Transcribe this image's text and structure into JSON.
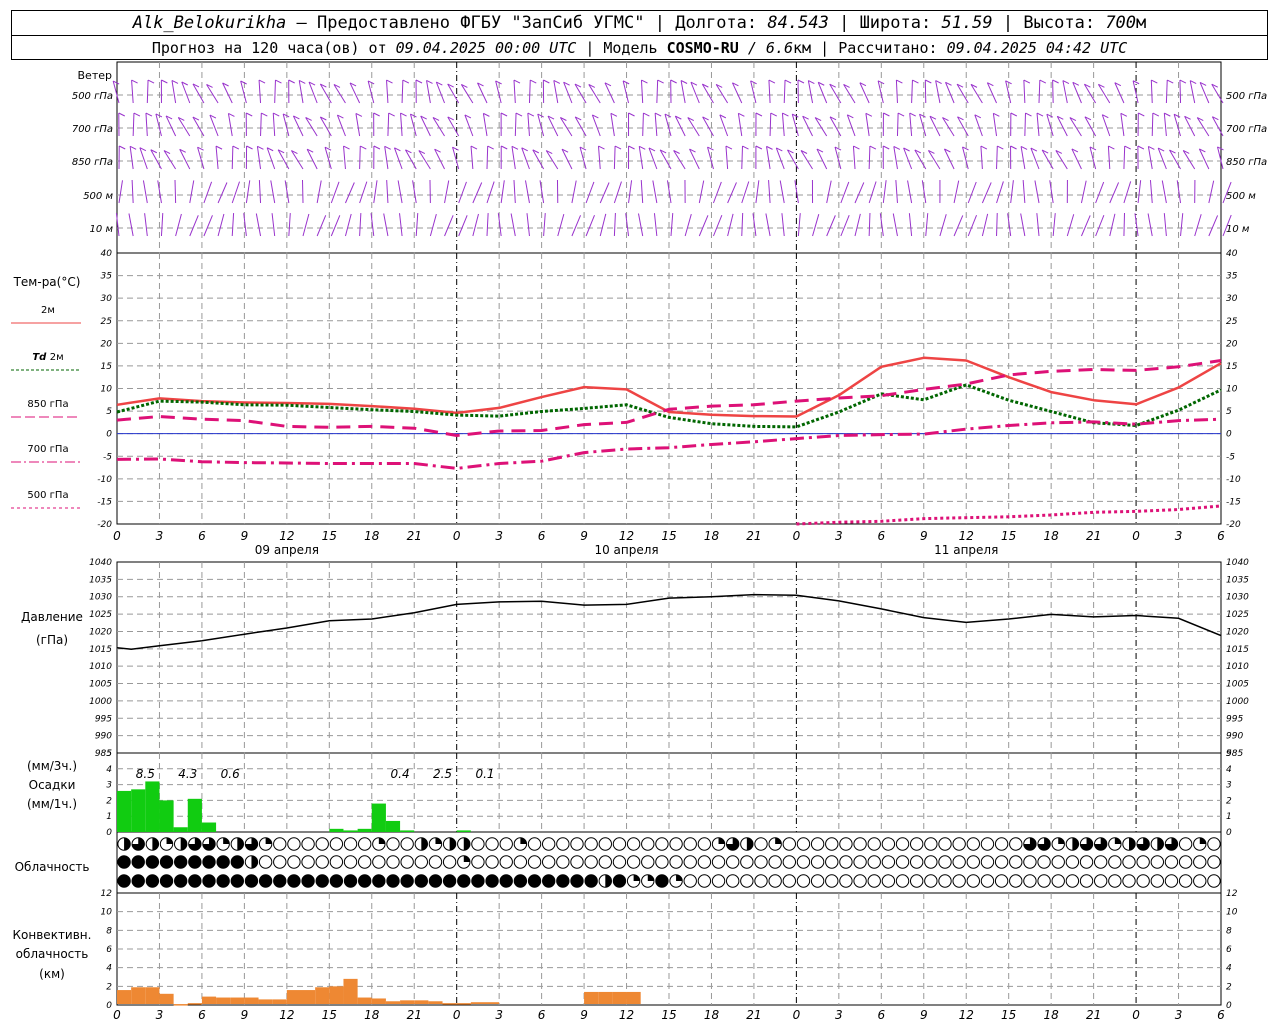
{
  "header": {
    "station": "Alk_Belokurikha",
    "provided": "– Предоставлено ФГБУ \"ЗапСиб УГМС\"",
    "lon_label": "Долгота:",
    "lon": "84.543",
    "lat_label": "Широта:",
    "lat": "51.59",
    "alt_label": "Высота:",
    "alt": "700",
    "alt_unit": "м",
    "forecast_label": "Прогноз на 120 часа(ов) от",
    "forecast_start": "09.04.2025 00:00 UTC",
    "model_label": "Модель",
    "model": "COSMO-RU",
    "resolution": "/ 6.6",
    "res_unit": "км",
    "calc_label": "Рассчитано:",
    "calc_time": "09.04.2025 04:42 UTC"
  },
  "wind_panel": {
    "title": "Ветер",
    "levels": [
      "500 гПа",
      "700 гПа",
      "850 гПа",
      "500 м",
      "10  м"
    ],
    "barb_color": "#9933cc"
  },
  "temperature_panel": {
    "title": "Тем-ра(°C)",
    "legend": [
      {
        "label": "2м",
        "color": "#ee4444",
        "style": "solid"
      },
      {
        "label_em": "Td",
        "label": "2м",
        "color": "#006600",
        "style": "dotted"
      },
      {
        "label": "850 гПа",
        "color": "#dd1177",
        "style": "dashed"
      },
      {
        "label": "700 гПа",
        "color": "#dd1177",
        "style": "dashdot"
      },
      {
        "label": "500 гПа",
        "color": "#dd1177",
        "style": "dot"
      }
    ]
  },
  "pressure_panel": {
    "title": "Давление",
    "unit": "(гПа)"
  },
  "precip_panel": {
    "unit3": "(мм/3ч.)",
    "title": "Осадки",
    "unit1": "(мм/1ч.)",
    "totals": [
      {
        "x": 2,
        "text": "8.5"
      },
      {
        "x": 5,
        "text": "4.3"
      },
      {
        "x": 8,
        "text": "0.6"
      },
      {
        "x": 20,
        "text": "0.4"
      },
      {
        "x": 23,
        "text": "2.5"
      },
      {
        "x": 26,
        "text": "0.1"
      }
    ]
  },
  "cloud_panel": {
    "title": "Облачность"
  },
  "convective_panel": {
    "lines": [
      "Конвективн.",
      "облачность",
      "(км)"
    ]
  },
  "time_axis": {
    "hour_labels": [
      "0",
      "3",
      "6",
      "9",
      "12",
      "15",
      "18",
      "21",
      "0",
      "3",
      "6",
      "9",
      "12",
      "15",
      "18",
      "21",
      "0",
      "3",
      "6",
      "9",
      "12",
      "15",
      "18",
      "21",
      "0",
      "3",
      "6"
    ],
    "day_labels": [
      {
        "x": 12,
        "text": "09 апреля"
      },
      {
        "x": 36,
        "text": "10 апреля"
      },
      {
        "x": 60,
        "text": "11 апреля"
      }
    ]
  },
  "colors": {
    "t2m": "#ee4444",
    "td2m": "#006600",
    "t850": "#dd1177",
    "zero_line": "#2233cc",
    "pressure": "#000000",
    "precip": "#11cc11",
    "convective": "#ee8833",
    "grid": "#999999"
  },
  "chart_data": [
    {
      "type": "line",
      "panel": "temperature",
      "x_unit": "forecast hour",
      "xlim": [
        0,
        78
      ],
      "ylim": [
        -20,
        40
      ],
      "yticks": [
        -20,
        -15,
        -10,
        -5,
        0,
        5,
        10,
        15,
        20,
        25,
        30,
        35,
        40
      ],
      "series": [
        {
          "key": "t2m",
          "x": [
            0,
            3,
            6,
            9,
            12,
            15,
            18,
            21,
            24,
            27,
            30,
            33,
            36,
            39,
            42,
            45,
            48,
            51,
            54,
            57,
            60,
            63,
            66,
            69,
            72,
            75,
            78
          ],
          "values": [
            6.4,
            7.8,
            7.2,
            6.9,
            6.8,
            6.6,
            6.1,
            5.5,
            4.6,
            5.7,
            8.1,
            10.3,
            9.8,
            4.8,
            4.2,
            3.9,
            3.8,
            8.5,
            14.8,
            16.8,
            16.2,
            12.5,
            9.2,
            7.4,
            6.5,
            10.2,
            15.6
          ]
        },
        {
          "key": "td2m",
          "x": [
            0,
            3,
            6,
            9,
            12,
            15,
            18,
            21,
            24,
            27,
            30,
            33,
            36,
            39,
            42,
            45,
            48,
            51,
            54,
            57,
            60,
            63,
            66,
            69,
            72,
            75,
            78
          ],
          "values": [
            4.8,
            7.2,
            7.0,
            6.4,
            6.3,
            5.8,
            5.3,
            4.9,
            4.1,
            3.9,
            4.9,
            5.6,
            6.4,
            3.6,
            2.2,
            1.6,
            1.5,
            4.8,
            8.8,
            7.5,
            10.8,
            7.4,
            4.9,
            2.4,
            1.8,
            5.2,
            9.7
          ]
        },
        {
          "key": "t850",
          "x": [
            0,
            3,
            6,
            9,
            12,
            15,
            18,
            21,
            24,
            27,
            30,
            33,
            36,
            39,
            42,
            45,
            48,
            51,
            54,
            57,
            60,
            63,
            66,
            69,
            72,
            75,
            78
          ],
          "values": [
            3.0,
            3.8,
            3.2,
            2.9,
            1.6,
            1.4,
            1.6,
            1.2,
            -0.4,
            0.6,
            0.7,
            2.0,
            2.5,
            5.4,
            6.1,
            6.4,
            7.2,
            7.9,
            8.4,
            9.8,
            11.0,
            13.0,
            13.8,
            14.2,
            14.0,
            14.8,
            16.2
          ]
        },
        {
          "key": "t700",
          "x": [
            0,
            3,
            6,
            9,
            12,
            15,
            18,
            21,
            24,
            27,
            30,
            33,
            36,
            39,
            42,
            45,
            48,
            51,
            54,
            57,
            60,
            63,
            66,
            69,
            72,
            75,
            78
          ],
          "values": [
            -5.7,
            -5.6,
            -6.2,
            -6.4,
            -6.5,
            -6.6,
            -6.6,
            -6.6,
            -7.7,
            -6.6,
            -6.1,
            -4.2,
            -3.4,
            -3.1,
            -2.4,
            -1.8,
            -1.1,
            -0.4,
            -0.2,
            -0.1,
            1.0,
            1.8,
            2.4,
            2.6,
            2.1,
            2.9,
            3.2
          ]
        },
        {
          "key": "t500",
          "x": [
            48,
            51,
            54,
            57,
            60,
            63,
            66,
            69,
            72,
            75,
            78
          ],
          "values": [
            -20.0,
            -19.6,
            -19.4,
            -18.8,
            -18.6,
            -18.4,
            -18.0,
            -17.4,
            -17.2,
            -16.8,
            -16.0
          ]
        }
      ]
    },
    {
      "type": "line",
      "panel": "pressure",
      "name": "",
      "x_unit": "forecast hour",
      "xlim": [
        0,
        78
      ],
      "ylim": [
        985,
        1040
      ],
      "yticks": [
        985,
        990,
        995,
        1000,
        1005,
        1010,
        1015,
        1020,
        1025,
        1030,
        1035,
        1040
      ],
      "x": [
        0,
        1,
        3,
        6,
        9,
        12,
        15,
        18,
        21,
        24,
        27,
        30,
        33,
        36,
        39,
        42,
        45,
        48,
        51,
        54,
        57,
        60,
        63,
        66,
        69,
        72,
        75,
        78
      ],
      "values": [
        1015.3,
        1014.9,
        1015.9,
        1017.3,
        1019.2,
        1021.0,
        1023.1,
        1023.6,
        1025.4,
        1027.8,
        1028.5,
        1028.7,
        1027.6,
        1027.8,
        1029.6,
        1030.0,
        1030.6,
        1030.4,
        1028.8,
        1026.5,
        1024.0,
        1022.6,
        1023.6,
        1024.9,
        1024.2,
        1024.6,
        1023.8,
        1018.8
      ]
    },
    {
      "type": "bar",
      "panel": "precipitation_1h",
      "x_unit": "forecast hour",
      "xlim": [
        0,
        78
      ],
      "ylim": [
        0,
        5
      ],
      "yticks": [
        0,
        1,
        2,
        3,
        4,
        5
      ],
      "x": [
        0,
        1,
        2,
        3,
        4,
        5,
        6,
        15,
        16,
        17,
        18,
        19,
        20,
        24
      ],
      "values": [
        2.6,
        2.7,
        3.2,
        2.0,
        0.3,
        2.1,
        0.6,
        0.2,
        0.1,
        0.2,
        1.8,
        0.7,
        0.1,
        0.1
      ]
    },
    {
      "type": "bar",
      "panel": "convective_cloud_top_km",
      "x_unit": "forecast hour",
      "xlim": [
        0,
        78
      ],
      "ylim": [
        0,
        12
      ],
      "yticks": [
        0,
        2,
        4,
        6,
        8,
        10,
        12
      ],
      "x": [
        0,
        1,
        2,
        3,
        4,
        5,
        6,
        7,
        8,
        9,
        10,
        11,
        12,
        13,
        14,
        15,
        16,
        17,
        18,
        19,
        20,
        21,
        22,
        23,
        24,
        25,
        26,
        33,
        34,
        35,
        36
      ],
      "values": [
        1.6,
        1.9,
        1.9,
        1.2,
        0.1,
        0.2,
        0.9,
        0.8,
        0.8,
        0.8,
        0.6,
        0.6,
        1.6,
        1.6,
        1.9,
        2.0,
        2.8,
        0.8,
        0.7,
        0.4,
        0.5,
        0.5,
        0.4,
        0.2,
        0.2,
        0.3,
        0.3,
        1.4,
        1.4,
        1.4,
        1.4
      ]
    },
    {
      "type": "table",
      "panel": "cloud_cover",
      "rows": [
        "upper",
        "middle",
        "lower"
      ],
      "fractions_per_hour": {
        "upper": [
          0.5,
          0.75,
          0.5,
          0.25,
          0.5,
          0.75,
          0.75,
          0.25,
          0.5,
          0.75,
          0.25,
          0,
          0,
          0,
          0,
          0,
          0,
          0,
          0.25,
          0,
          0,
          0.5,
          0.25,
          0.5,
          0.5,
          0,
          0,
          0,
          0.25,
          0,
          0,
          0,
          0,
          0,
          0,
          0,
          0,
          0,
          0,
          0,
          0,
          0,
          0.25,
          0.75,
          0.5,
          0,
          0.25,
          0,
          0,
          0,
          0,
          0,
          0,
          0,
          0,
          0,
          0,
          0,
          0,
          0,
          0,
          0,
          0,
          0,
          0.75,
          0.75,
          0.25,
          0.5,
          0.75,
          0.75,
          0.25,
          0.5,
          0.75,
          0.5,
          0.75,
          0,
          0.25,
          0
        ],
        "middle": [
          1,
          1,
          1,
          1,
          1,
          1,
          1,
          1,
          1,
          0.5,
          0,
          0,
          0,
          0,
          0,
          0,
          0,
          0,
          0,
          0,
          0,
          0,
          0,
          0,
          0.25,
          0,
          0,
          0,
          0,
          0,
          0,
          0,
          0,
          0,
          0,
          0,
          0,
          0,
          0,
          0,
          0,
          0,
          0,
          0,
          0,
          0,
          0,
          0,
          0,
          0,
          0,
          0,
          0,
          0,
          0,
          0,
          0,
          0,
          0,
          0,
          0,
          0,
          0,
          0,
          0,
          0,
          0,
          0,
          0,
          0,
          0,
          0,
          0,
          0,
          0,
          0,
          0,
          0
        ],
        "lower": [
          1,
          1,
          1,
          1,
          1,
          1,
          1,
          1,
          1,
          1,
          1,
          1,
          1,
          1,
          1,
          1,
          1,
          1,
          1,
          1,
          1,
          1,
          1,
          1,
          1,
          1,
          1,
          1,
          1,
          1,
          1,
          1,
          1,
          1,
          0.5,
          1,
          0.25,
          0.25,
          1,
          0.25,
          0,
          0,
          0,
          0,
          0,
          0,
          0,
          0,
          0,
          0,
          0,
          0,
          0,
          0,
          0,
          0,
          0,
          0,
          0,
          0,
          0,
          0,
          0,
          0,
          0,
          0,
          0,
          0,
          0,
          0,
          0,
          0,
          0,
          0,
          0,
          0,
          0,
          0
        ]
      }
    }
  ]
}
